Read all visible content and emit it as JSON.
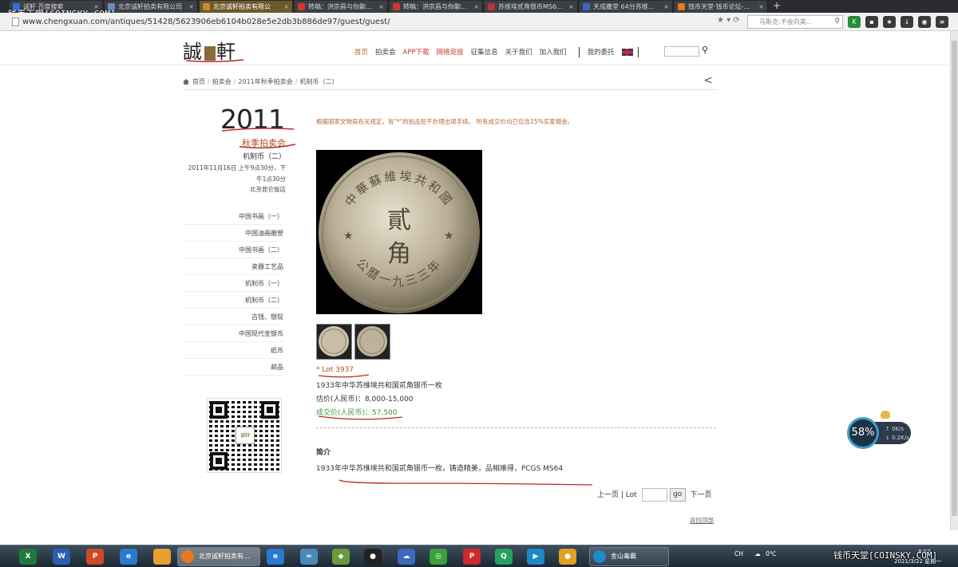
{
  "watermark": "钱币天堂[COINSKY.COM]",
  "tabs": [
    {
      "label": "诚轩 百度搜索",
      "color": "#2f6ee0"
    },
    {
      "label": "北京诚轩拍卖有限公司",
      "color": "#6b8cc0"
    },
    {
      "label": "北京诚轩拍卖有限公",
      "color": "#c98b2a",
      "active": true
    },
    {
      "label": "转稿：洪宗昌与你聊...",
      "color": "#d03a2a"
    },
    {
      "label": "转稿：洪宗昌与你聊...",
      "color": "#d03a2a"
    },
    {
      "label": "苏维埃贰角银币MS6...",
      "color": "#c03030"
    },
    {
      "label": "天成撒堂 64分苏维...",
      "color": "#3a6ac0"
    },
    {
      "label": "钱币天堂·钱币论坛-...",
      "color": "#e07a1a"
    }
  ],
  "newtab": "+",
  "address": {
    "url": "www.chengxuan.com/antiques/51428/5623906eb6104b028e5e2db3b886de97/guest/guest/",
    "search_placeholder": "马斯克:不会向美..."
  },
  "site": {
    "logo_left": "誠",
    "logo_right": "軒",
    "nav": [
      {
        "label": "首页",
        "style": "hl"
      },
      {
        "label": "拍卖会",
        "style": ""
      },
      {
        "label": "APP下载",
        "style": "red"
      },
      {
        "label": "网络竞投",
        "style": "red"
      },
      {
        "label": "征集信息",
        "style": ""
      },
      {
        "label": "关于我们",
        "style": ""
      },
      {
        "label": "加入我们",
        "style": ""
      }
    ],
    "my_consign": "我的委托"
  },
  "breadcrumb": [
    "首页",
    "拍卖会",
    "2011年秋季拍卖会",
    "机制币（二）"
  ],
  "breadcrumb_back": "<",
  "auction": {
    "year": "2011",
    "season": "秋季拍卖会",
    "session": "机制币（二）",
    "datetime": "2011年11月16日 上午9点30分，下午1点30分",
    "venue": "北京昆仑饭店"
  },
  "categories": [
    "中国书画（一）",
    "中国油画雕塑",
    "中国书画（二）",
    "瓷器工艺品",
    "机制币（一）",
    "机制币（二）",
    "古钱、银锭",
    "中国现代金银币",
    "纸币",
    "邮品"
  ],
  "qr_center": "诚轩",
  "notice": "根据国家文物局有关规定，有\"*\"的拍品恕不办理出境手续。 所有成交价均已包含15%买家佣金。",
  "coin": {
    "top_text": "中華蘇維埃共和國",
    "center_top": "貳",
    "center_bottom": "角",
    "bottom_text": "公曆一九三三年"
  },
  "lot": {
    "number": "* Lot 3937",
    "title": "1933年中华苏维埃共和国贰角银币一枚",
    "estimate": "估价(人民币)：8,000-15,000",
    "sold": "成交价(人民币)：57,500"
  },
  "intro": {
    "heading": "简介",
    "text": "1933年中华苏维埃共和国贰角银币一枚，铸造精美，品相难得，PCGS MS64"
  },
  "pager": {
    "prev": "上一页",
    "lot_label": "Lot",
    "go": "go",
    "next": "下一页"
  },
  "back_to_top": "返回顶部",
  "speed_widget": {
    "percent": "58%",
    "up": "0K/s",
    "down": "0.2K/s"
  },
  "taskbar": {
    "apps": [
      {
        "label": "X",
        "color": "#1f7a3a"
      },
      {
        "label": "W",
        "color": "#2a5fb0"
      },
      {
        "label": "P",
        "color": "#d04a24"
      },
      {
        "label": "e",
        "color": "#2a7ad0"
      },
      {
        "label": "",
        "color": "#e8a030"
      }
    ],
    "task_browser": "北京诚轩拍卖有...",
    "task_other": "金山毒霸",
    "tray_lang": "CH",
    "tray_temp": "0℃",
    "time": "8:52",
    "date": "2021/3/22 星期一"
  },
  "colors": {
    "accent_red": "#c73a2c",
    "sold_green": "#3a9a3a",
    "lot_orange": "#b0501e",
    "notice_brown": "#b06a3a"
  }
}
